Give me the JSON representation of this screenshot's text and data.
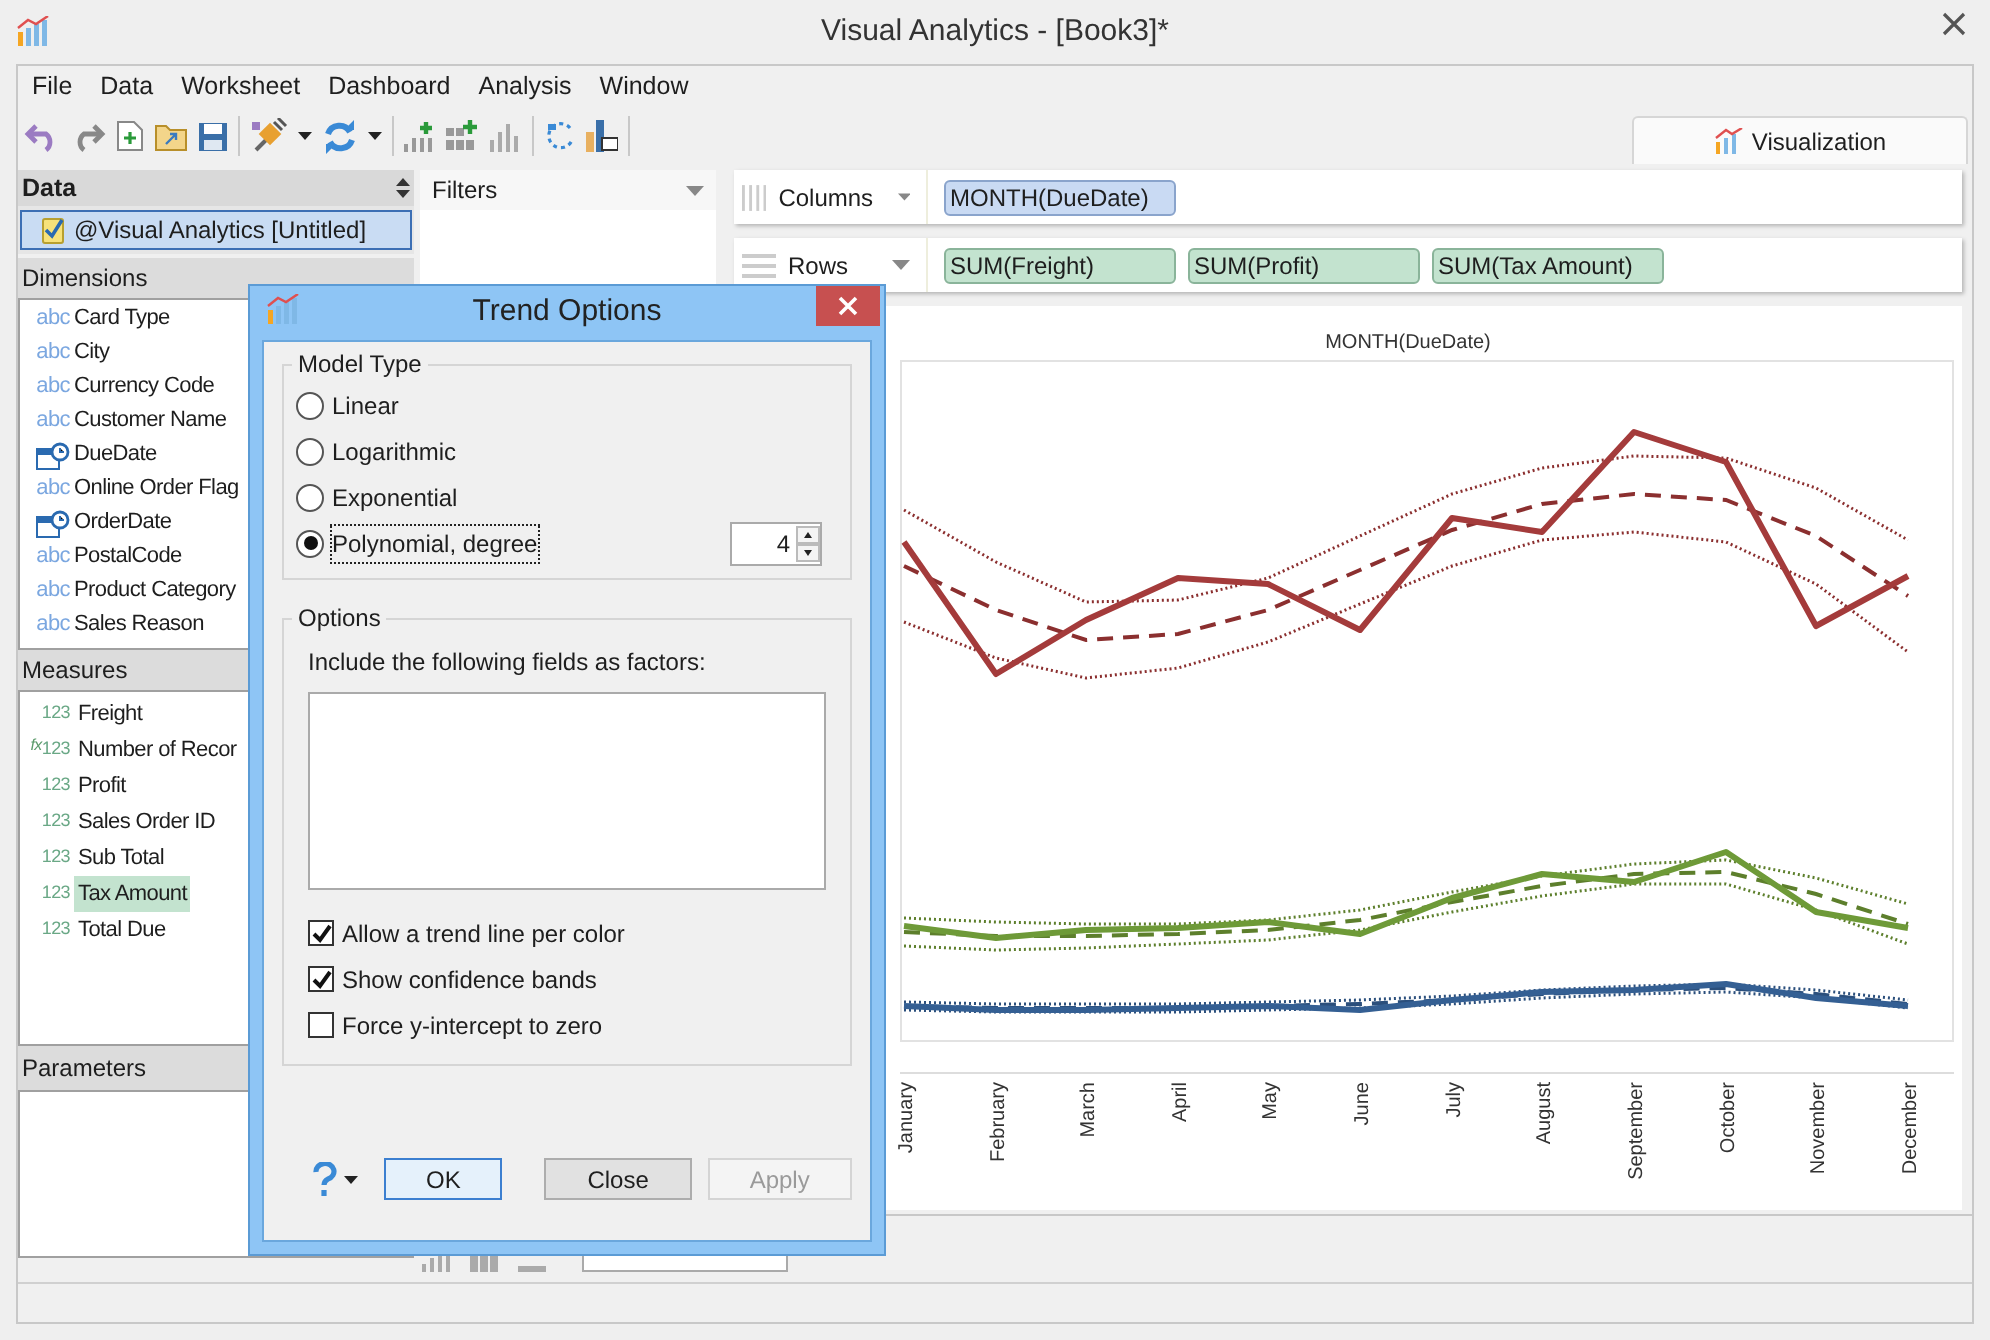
{
  "window": {
    "title": "Visual Analytics - [Book3]*"
  },
  "menu": [
    "File",
    "Data",
    "Worksheet",
    "Dashboard",
    "Analysis",
    "Window"
  ],
  "visualization_tab": {
    "label": "Visualization",
    "selected": true
  },
  "data_panel": {
    "title": "Data",
    "source": {
      "label": "@Visual Analytics [Untitled]",
      "selected": true
    }
  },
  "dimensions": {
    "title": "Dimensions",
    "items": [
      {
        "kind": "text",
        "badge": "abc",
        "label": "Card Type"
      },
      {
        "kind": "text",
        "badge": "abc",
        "label": "City"
      },
      {
        "kind": "text",
        "badge": "abc",
        "label": "Currency Code"
      },
      {
        "kind": "text",
        "badge": "abc",
        "label": "Customer Name"
      },
      {
        "kind": "date",
        "label": "DueDate"
      },
      {
        "kind": "text",
        "badge": "abc",
        "label": "Online Order Flag"
      },
      {
        "kind": "date",
        "label": "OrderDate"
      },
      {
        "kind": "text",
        "badge": "abc",
        "label": "PostalCode"
      },
      {
        "kind": "text",
        "badge": "abc",
        "label": "Product Category"
      },
      {
        "kind": "text",
        "badge": "abc",
        "label": "Sales Reason"
      }
    ]
  },
  "measures": {
    "title": "Measures",
    "items": [
      {
        "kind": "number",
        "badge": "123",
        "label": "Freight",
        "selected": false
      },
      {
        "kind": "calculated",
        "formula": "fx",
        "badge": "123",
        "label": "Number of Recor",
        "selected": false
      },
      {
        "kind": "number",
        "badge": "123",
        "label": "Profit",
        "selected": false
      },
      {
        "kind": "number",
        "badge": "123",
        "label": "Sales Order ID",
        "selected": false
      },
      {
        "kind": "number",
        "badge": "123",
        "label": "Sub Total",
        "selected": false
      },
      {
        "kind": "number",
        "badge": "123",
        "label": "Tax Amount",
        "selected": true
      },
      {
        "kind": "number",
        "badge": "123",
        "label": "Total Due",
        "selected": false
      }
    ]
  },
  "parameters": {
    "title": "Parameters"
  },
  "filters": {
    "title": "Filters"
  },
  "shelves": [
    {
      "label": "Columns",
      "kind": "columns",
      "pills": [
        "MONTH(DueDate)"
      ]
    },
    {
      "label": "Rows",
      "kind": "rows",
      "pills": [
        "SUM(Freight)",
        "SUM(Profit)",
        "SUM(Tax Amount)"
      ]
    }
  ],
  "chart": {
    "title": "MONTH(DueDate)",
    "x_labels": [
      "January",
      "February",
      "March",
      "April",
      "May",
      "June",
      "July",
      "August",
      "September",
      "October",
      "November",
      "December"
    ]
  },
  "dialog": {
    "title": "Trend Options",
    "model_type": {
      "title": "Model Type",
      "options": [
        {
          "label": "Linear",
          "selected": false
        },
        {
          "label": "Logarithmic",
          "selected": false
        },
        {
          "label": "Exponential",
          "selected": false
        },
        {
          "label": "Polynomial, degree",
          "selected": true
        }
      ],
      "degree": "4"
    },
    "options": {
      "title": "Options",
      "factors_label": "Include the following fields as factors:",
      "checkboxes": [
        {
          "label": "Allow a trend line per color",
          "checked": true
        },
        {
          "label": "Show confidence bands",
          "checked": true
        },
        {
          "label": "Force y-intercept to zero",
          "checked": false
        }
      ]
    },
    "buttons": [
      {
        "label": "OK",
        "default": true,
        "disabled": false
      },
      {
        "label": "Close",
        "default": false,
        "disabled": false
      },
      {
        "label": "Apply",
        "default": false,
        "disabled": true
      }
    ]
  }
}
